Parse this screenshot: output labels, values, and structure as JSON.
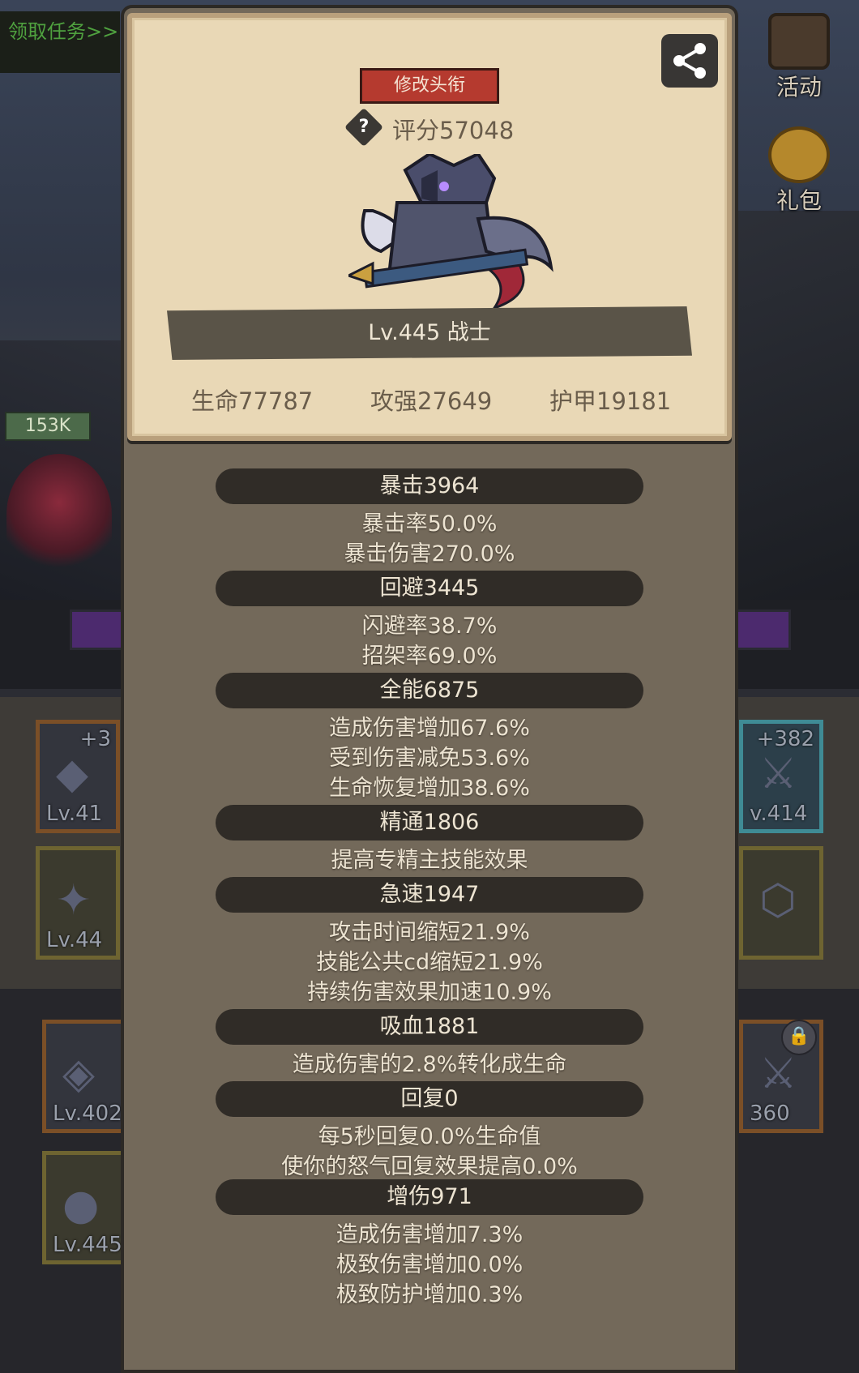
{
  "background": {
    "quest_link": "领取任务>>",
    "hp_badge": "153K",
    "activity_label": "活动",
    "gift_label": "礼包",
    "slots": [
      {
        "level": "Lv.41",
        "plus": "+3"
      },
      {
        "level": "Lv.44",
        "plus": ""
      },
      {
        "level": "Lv.402",
        "plus": ""
      },
      {
        "level": "Lv.445",
        "plus": ""
      },
      {
        "level": "v.414",
        "plus": "+382"
      },
      {
        "level": "",
        "plus": ""
      },
      {
        "level": "360",
        "plus": ""
      }
    ]
  },
  "card": {
    "title_button": "修改头衔",
    "help": "?",
    "score": "评分57048",
    "level_class": "Lv.445 战士",
    "stats": {
      "life": "生命77787",
      "attack": "攻强27649",
      "armor": "护甲19181"
    }
  },
  "sections": [
    {
      "header": "暴击3964",
      "lines": [
        "暴击率50.0%",
        "暴击伤害270.0%"
      ]
    },
    {
      "header": "回避3445",
      "lines": [
        "闪避率38.7%",
        "招架率69.0%"
      ]
    },
    {
      "header": "全能6875",
      "lines": [
        "造成伤害增加67.6%",
        "受到伤害减免53.6%",
        "生命恢复增加38.6%"
      ]
    },
    {
      "header": "精通1806",
      "lines": [
        "提高专精主技能效果"
      ]
    },
    {
      "header": "急速1947",
      "lines": [
        "攻击时间缩短21.9%",
        "技能公共cd缩短21.9%",
        "持续伤害效果加速10.9%"
      ]
    },
    {
      "header": "吸血1881",
      "lines": [
        "造成伤害的2.8%转化成生命"
      ]
    },
    {
      "header": "回复0",
      "lines": [
        "每5秒回复0.0%生命值",
        "使你的怒气回复效果提高0.0%"
      ]
    },
    {
      "header": "增伤971",
      "lines": [
        "造成伤害增加7.3%",
        "极致伤害增加0.0%",
        "极致防护增加0.3%"
      ]
    }
  ],
  "colors": {
    "card_bg": "#e9d8b6",
    "panel_bg": "#73695a",
    "header_pill": "#302c27",
    "title_button": "#b53a2f"
  }
}
